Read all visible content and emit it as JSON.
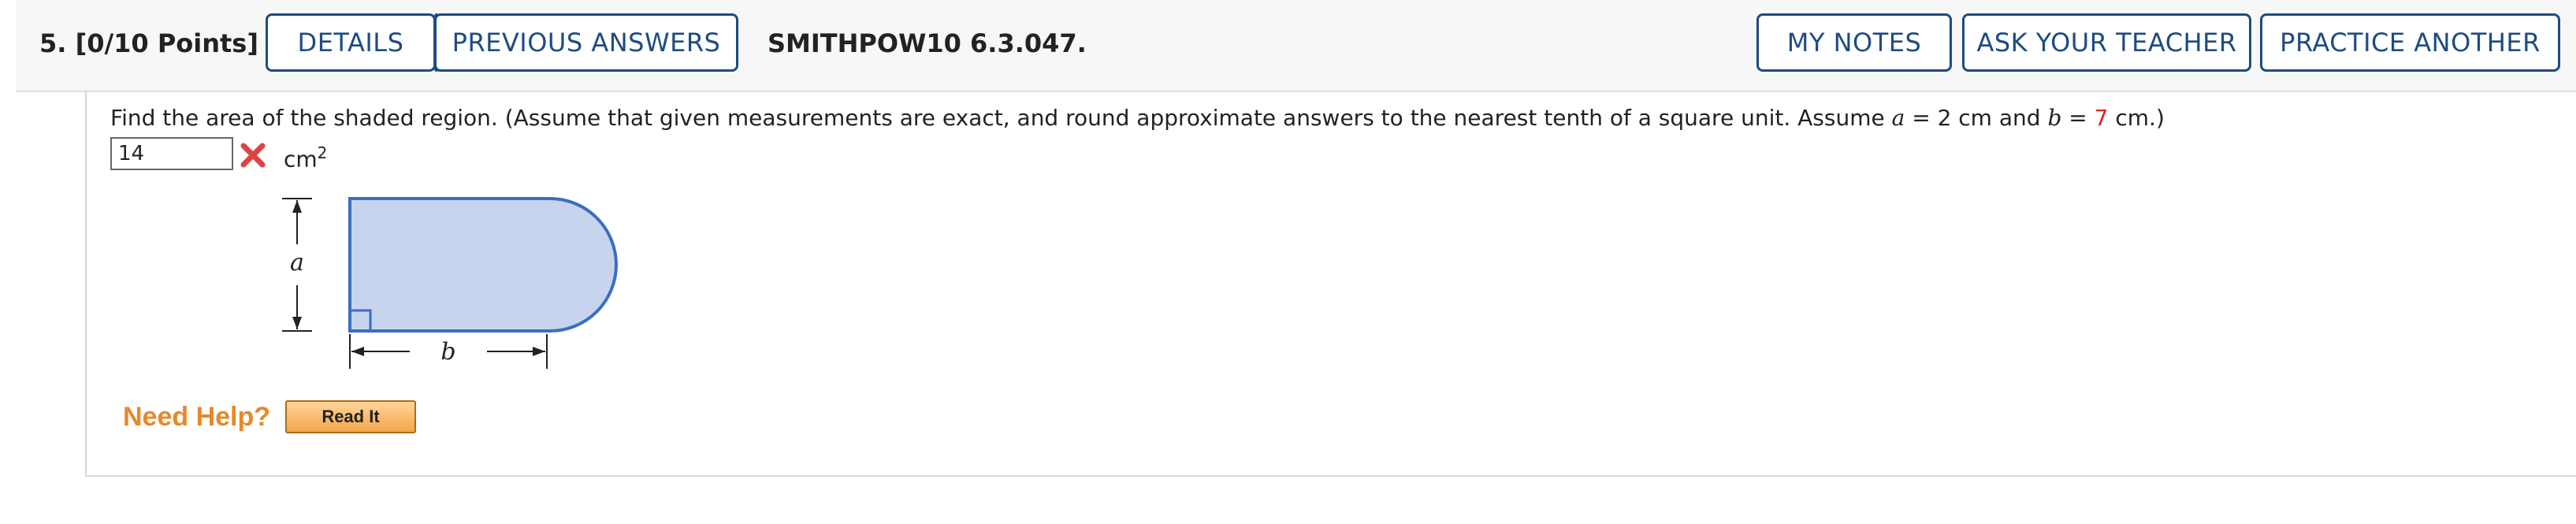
{
  "header": {
    "question_number": "5. [0/10 Points]",
    "details_label": "DETAILS",
    "previous_answers_label": "PREVIOUS ANSWERS",
    "problem_code": "SMITHPOW10 6.3.047.",
    "my_notes_label": "MY NOTES",
    "ask_teacher_label": "ASK YOUR TEACHER",
    "practice_another_label": "PRACTICE ANOTHER"
  },
  "question": {
    "prompt_part1": "Find the area of the shaded region. (Assume that given measurements are exact, and round approximate answers to the nearest tenth of a square unit. Assume ",
    "var_a": "a",
    "eq_a": " = 2 cm and ",
    "var_b": "b",
    "eq_b": " = ",
    "b_value": "7",
    "prompt_end": " cm.)",
    "answer_value": "14",
    "unit": "cm",
    "unit_exp": "2",
    "status": "incorrect"
  },
  "figure": {
    "label_a": "a",
    "label_b": "b",
    "fill_color": "#c8d4ee",
    "stroke_color": "#3a6fc0"
  },
  "help": {
    "need_help_label": "Need Help?",
    "read_it_label": "Read It"
  },
  "colors": {
    "accent": "#1e4b82",
    "incorrect": "#dd4444",
    "help": "#e8882a"
  }
}
